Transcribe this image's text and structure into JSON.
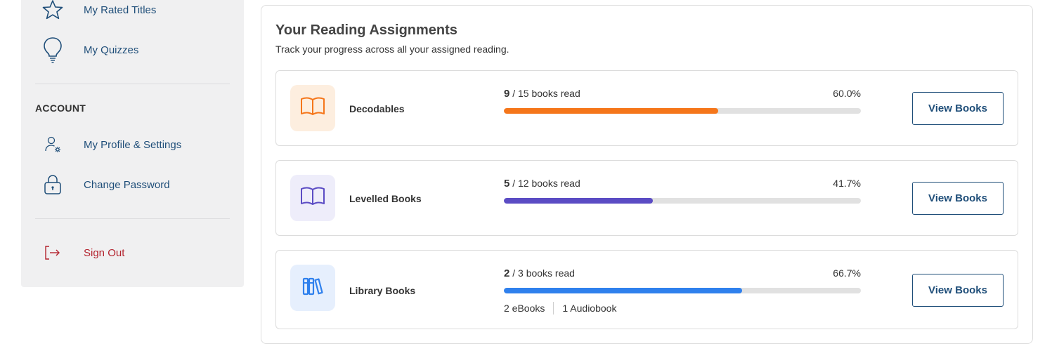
{
  "sidebar": {
    "items_top": [
      {
        "label": "My Rated Titles",
        "icon": "star-icon"
      },
      {
        "label": "My Quizzes",
        "icon": "lightbulb-icon"
      }
    ],
    "account_label": "ACCOUNT",
    "items_account": [
      {
        "label": "My Profile & Settings",
        "icon": "user-settings-icon"
      },
      {
        "label": "Change Password",
        "icon": "lock-icon"
      }
    ],
    "signout": {
      "label": "Sign Out",
      "icon": "sign-out-icon"
    }
  },
  "main": {
    "title": "Your Reading Assignments",
    "subtitle": "Track your progress across all your assigned reading.",
    "cards": [
      {
        "name": "Decodables",
        "read": "9",
        "total_text": " / 15 books read",
        "percent_text": "60.0%",
        "progress": 0.6,
        "button": "View Books",
        "icon": "open-book-icon",
        "accent": "#f5761a",
        "icon_bg": "#fdeedf"
      },
      {
        "name": "Levelled Books",
        "read": "5",
        "total_text": " / 12 books read",
        "percent_text": "41.7%",
        "progress": 0.417,
        "button": "View Books",
        "icon": "open-book-icon",
        "accent": "#5b4cc4",
        "icon_bg": "#eeedfa"
      },
      {
        "name": "Library Books",
        "read": "2",
        "total_text": " / 3 books read",
        "percent_text": "66.7%",
        "progress": 0.667,
        "button": "View Books",
        "icon": "books-shelf-icon",
        "accent": "#2f80ed",
        "icon_bg": "#e6effd",
        "extra": {
          "ebooks": "2 eBooks",
          "audiobooks": "1 Audiobook"
        }
      }
    ]
  }
}
